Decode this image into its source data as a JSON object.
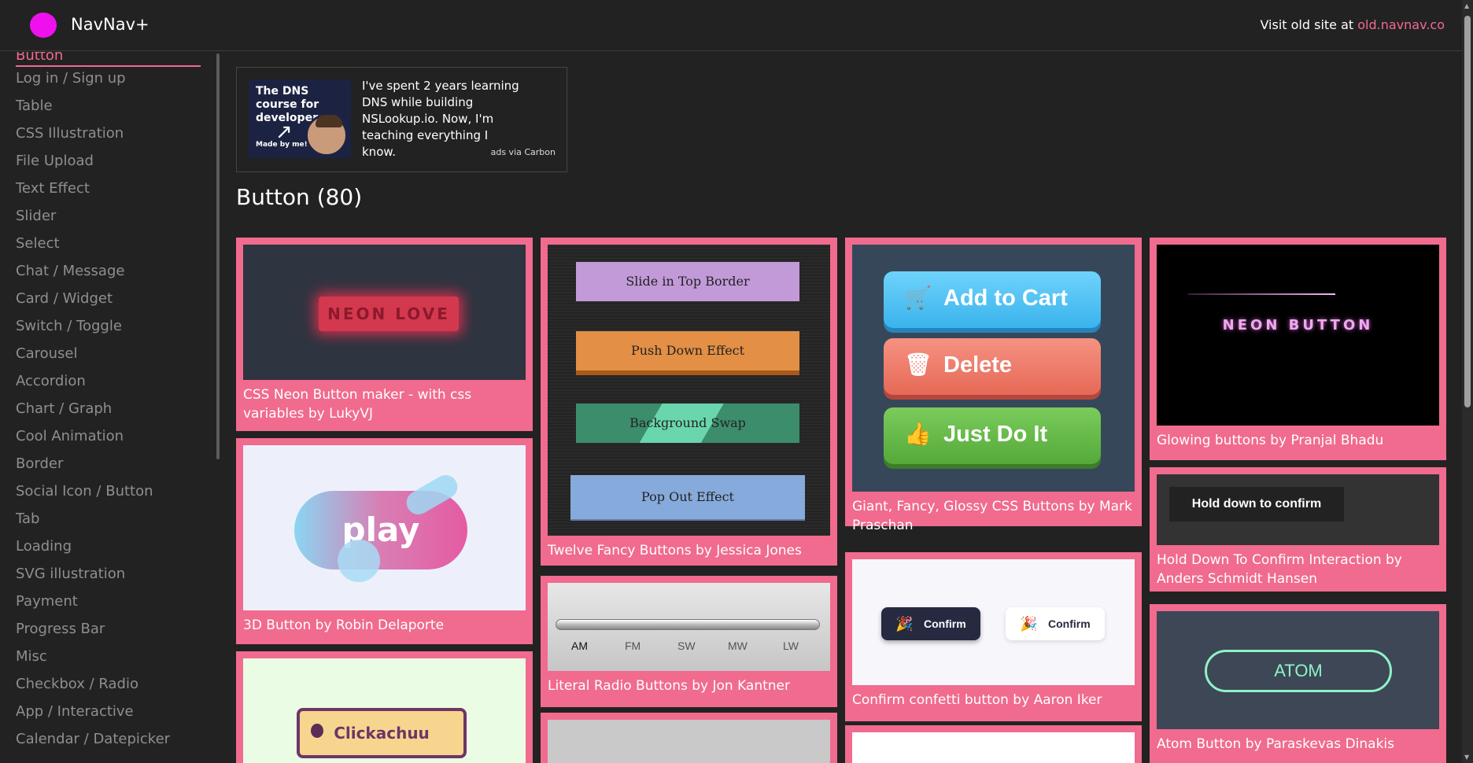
{
  "header": {
    "brand": "NavNav+",
    "visit_prefix": "Visit old site at ",
    "visit_link": "old.navnav.co",
    "logo_color": "#ee11ee"
  },
  "sidebar": {
    "items": [
      {
        "label": "Button",
        "active": true
      },
      {
        "label": "Log in / Sign up"
      },
      {
        "label": "Table"
      },
      {
        "label": "CSS Illustration"
      },
      {
        "label": "File Upload"
      },
      {
        "label": "Text Effect"
      },
      {
        "label": "Slider"
      },
      {
        "label": "Select"
      },
      {
        "label": "Chat / Message"
      },
      {
        "label": "Card / Widget"
      },
      {
        "label": "Switch / Toggle"
      },
      {
        "label": "Carousel"
      },
      {
        "label": "Accordion"
      },
      {
        "label": "Chart / Graph"
      },
      {
        "label": "Cool Animation"
      },
      {
        "label": "Border"
      },
      {
        "label": "Social Icon / Button"
      },
      {
        "label": " Tab"
      },
      {
        "label": "Loading"
      },
      {
        "label": "SVG illustration"
      },
      {
        "label": "Payment"
      },
      {
        "label": "Progress Bar"
      },
      {
        "label": "Misc"
      },
      {
        "label": "Checkbox / Radio"
      },
      {
        "label": "App / Interactive"
      },
      {
        "label": "Calendar / Datepicker"
      }
    ]
  },
  "ad": {
    "image_title": "The DNS course for developers",
    "image_sub": "Made by me!",
    "text": "I've spent 2 years learning DNS while building NSLookup.io. Now, I'm teaching everything I know.",
    "via": "ads via Carbon"
  },
  "main": {
    "title": "Button (80)"
  },
  "cards": {
    "neon": {
      "caption": "CSS Neon Button maker - with css variables by LukyVJ",
      "thumb_text": "NEON LOVE"
    },
    "play": {
      "caption": "3D Button by Robin Delaporte",
      "thumb_text": "play"
    },
    "click": {
      "thumb_text": "Clickachuu"
    },
    "fancy": {
      "caption": "Twelve Fancy Buttons by Jessica Jones",
      "buttons": [
        "Slide in Top Border",
        "Push Down Effect",
        "Background Swap",
        "Pop Out Effect"
      ]
    },
    "radio": {
      "caption": "Literal Radio Buttons by Jon Kantner",
      "labels": [
        "AM",
        "FM",
        "SW",
        "MW",
        "LW"
      ]
    },
    "glossy": {
      "caption": "Giant, Fancy, Glossy CSS Buttons by Mark Praschan",
      "buttons": [
        "Add to Cart",
        "Delete",
        "Just Do It"
      ]
    },
    "confirm": {
      "caption": "Confirm confetti button by Aaron Iker",
      "buttons": [
        "Confirm",
        "Confirm"
      ]
    },
    "glowing": {
      "caption": "Glowing buttons by Pranjal Bhadu",
      "thumb_text": "NEON BUTTON"
    },
    "hold": {
      "caption": "Hold Down To Confirm Interaction by Anders Schmidt Hansen",
      "thumb_text": "Hold down to confirm"
    },
    "atom": {
      "caption": "Atom Button by Paraskevas Dinakis",
      "thumb_text": "ATOM"
    }
  },
  "colors": {
    "accent": "#f06b8e",
    "background": "#222223",
    "sidebar_text": "#8f8f8f"
  }
}
